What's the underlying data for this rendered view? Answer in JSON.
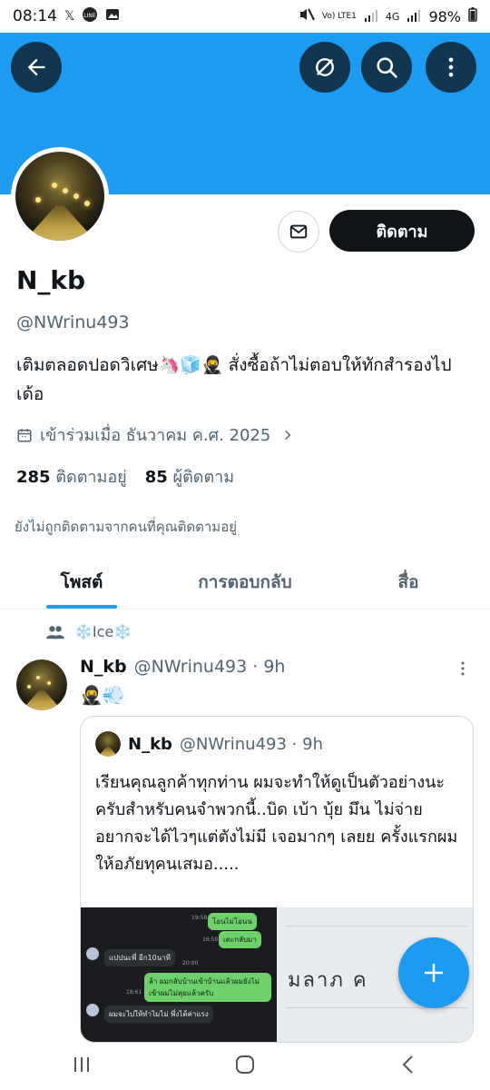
{
  "status_bar": {
    "time": "08:14",
    "battery": "98%",
    "network": "4G",
    "volte": "Vo) LTE1"
  },
  "header_actions": {
    "back_icon": "back-arrow-icon",
    "grok_icon": "slash-circle-icon",
    "search_icon": "search-icon",
    "more_icon": "more-vertical-icon"
  },
  "profile": {
    "name": "N_kb",
    "handle": "@NWrinu493",
    "bio": "เติมตลอดปอดวิเศษ🦄🧊🥷 สั่งซื้อถ้าไม่ตอบให้ทักสำรองไปเด้อ",
    "joined": "เข้าร่วมเมื่อ ธันวาคม ค.ศ. 2025",
    "following_count": "285",
    "following_label": "ติดตามอยู่",
    "followers_count": "85",
    "followers_label": "ผู้ติดตาม",
    "not_followed_note": "ยังไม่ถูกติดตามจากคนที่คุณติดตามอยู่",
    "follow_button": "ติดตาม"
  },
  "tabs": [
    {
      "label": "โพสต์",
      "active": true
    },
    {
      "label": "การตอบกลับ",
      "active": false
    },
    {
      "label": "สื่อ",
      "active": false
    }
  ],
  "post": {
    "community": "❄️Ice❄️",
    "author_name": "N_kb",
    "author_handle": "@NWrinu493 · 9h",
    "text": "🥷💨",
    "quote": {
      "author_name": "N_kb",
      "author_handle": "@NWrinu493 · 9h",
      "text": "เรียนคุณลูกค้าทุกท่าน ผมจะทำให้ดูเป็นตัวอย่างนะครับสำหรับคนจำพวกนี้..บิด เบ้า บุ้ย มึน ไม่จ่าย อยากจะได้ไวๆแต่ตังไม่มี เจอมากๆ เลยย ครั้งแรกผมให้อภัยทุคนเสมอ.....",
      "chat_lines": [
        "โอนไม่โอนน",
        "เตะกลับมา",
        "แปปนะพี่ อีก10นาที",
        "ล้า ผมกลับบ้านเข้าบ้านแล้วผมยังไม่เข้าผมไม่คุยแล้วครับ",
        "ผมจะไปให้ทำไมไม่ พึ่งได้ค่าแรง"
      ],
      "chat_times": [
        "19:58",
        "16:50",
        "20:00",
        "18:61"
      ],
      "doc_text": "มลาภ ค"
    }
  },
  "colors": {
    "banner": "#1d9bf0",
    "accent": "#1d9bf0",
    "text": "#0f1419",
    "muted": "#536471"
  }
}
